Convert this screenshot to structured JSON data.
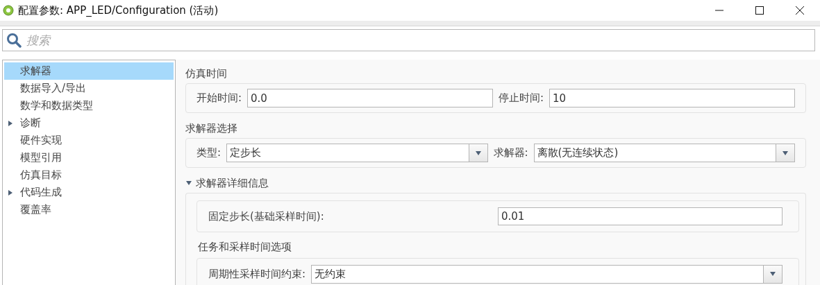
{
  "window": {
    "title": "配置参数: APP_LED/Configuration (活动)"
  },
  "search": {
    "placeholder": "搜索"
  },
  "sidebar": {
    "items": [
      {
        "label": "求解器",
        "selected": true,
        "collapsible": false
      },
      {
        "label": "数据导入/导出",
        "selected": false,
        "collapsible": false
      },
      {
        "label": "数学和数据类型",
        "selected": false,
        "collapsible": false
      },
      {
        "label": "诊断",
        "selected": false,
        "collapsible": true
      },
      {
        "label": "硬件实现",
        "selected": false,
        "collapsible": false
      },
      {
        "label": "模型引用",
        "selected": false,
        "collapsible": false
      },
      {
        "label": "仿真目标",
        "selected": false,
        "collapsible": false
      },
      {
        "label": "代码生成",
        "selected": false,
        "collapsible": true
      },
      {
        "label": "覆盖率",
        "selected": false,
        "collapsible": false
      }
    ]
  },
  "sections": [
    {
      "title": "仿真时间",
      "fields": [
        {
          "kind": "text",
          "label": "开始时间:",
          "value": "0.0"
        },
        {
          "kind": "text",
          "label": "停止时间:",
          "value": "10"
        }
      ]
    },
    {
      "title": "求解器选择",
      "fields": [
        {
          "kind": "dropdown",
          "label": "类型:",
          "value": "定步长"
        },
        {
          "kind": "dropdown",
          "label": "求解器:",
          "value": "离散(无连续状态)"
        }
      ]
    },
    {
      "title": "求解器详细信息",
      "expanded": true,
      "subsections": [
        {
          "fields": [
            {
              "kind": "text",
              "label": "固定步长(基础采样时间):",
              "value": "0.01"
            }
          ]
        },
        {
          "title": "任务和采样时间选项",
          "fields": [
            {
              "kind": "dropdown",
              "label": "周期性采样时间约束:",
              "value": "无约束"
            }
          ]
        }
      ]
    }
  ]
}
